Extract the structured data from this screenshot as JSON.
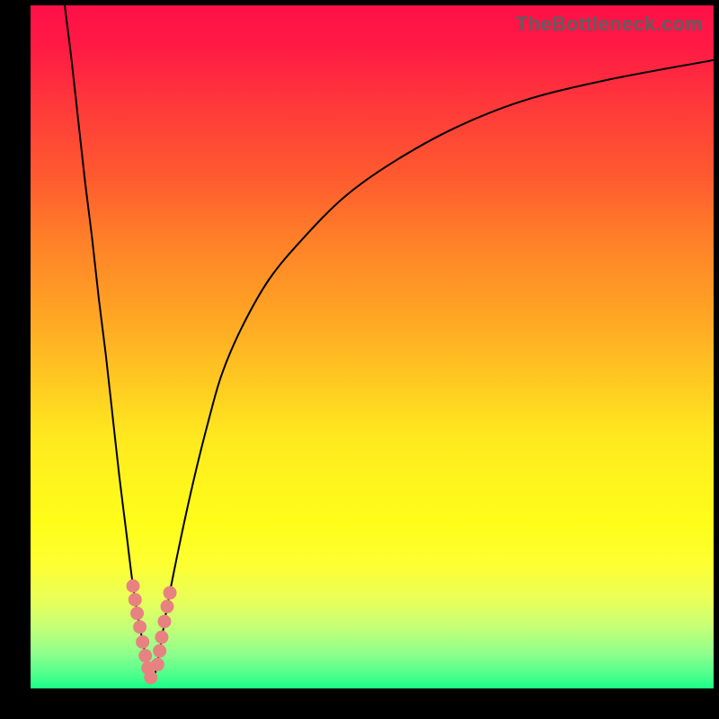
{
  "attribution": "TheBottleneck.com",
  "colors": {
    "background": "#000000",
    "gradient_top": "#ff1048",
    "gradient_bottom": "#19ff86",
    "curve": "#000000",
    "marker": "#e88281"
  },
  "chart_data": {
    "type": "line",
    "title": "",
    "xlabel": "",
    "ylabel": "",
    "xlim": [
      0,
      100
    ],
    "ylim": [
      0,
      100
    ],
    "series": [
      {
        "name": "left-curve",
        "x": [
          5,
          6,
          7,
          8,
          9,
          10,
          11,
          12,
          13,
          14,
          15,
          16,
          17,
          17.5
        ],
        "values": [
          100,
          92,
          83,
          74,
          66,
          57,
          49,
          40,
          31,
          23,
          15,
          9,
          4,
          1
        ]
      },
      {
        "name": "right-curve",
        "x": [
          18,
          19,
          20,
          22,
          24,
          26,
          28,
          31,
          35,
          40,
          46,
          53,
          62,
          72,
          84,
          100
        ],
        "values": [
          1,
          6,
          12,
          22,
          31,
          39,
          46,
          53,
          60,
          66,
          72,
          77,
          82,
          86,
          89,
          92
        ]
      }
    ],
    "markers": [
      {
        "x": 15.0,
        "y": 15.0
      },
      {
        "x": 15.3,
        "y": 13.0
      },
      {
        "x": 15.6,
        "y": 11.0
      },
      {
        "x": 16.0,
        "y": 9.0
      },
      {
        "x": 16.4,
        "y": 6.8
      },
      {
        "x": 16.8,
        "y": 4.8
      },
      {
        "x": 17.2,
        "y": 3.0
      },
      {
        "x": 17.6,
        "y": 1.6
      },
      {
        "x": 18.6,
        "y": 3.5
      },
      {
        "x": 18.9,
        "y": 5.5
      },
      {
        "x": 19.2,
        "y": 7.5
      },
      {
        "x": 19.6,
        "y": 9.8
      },
      {
        "x": 20.0,
        "y": 12.0
      },
      {
        "x": 20.4,
        "y": 14.0
      }
    ]
  }
}
